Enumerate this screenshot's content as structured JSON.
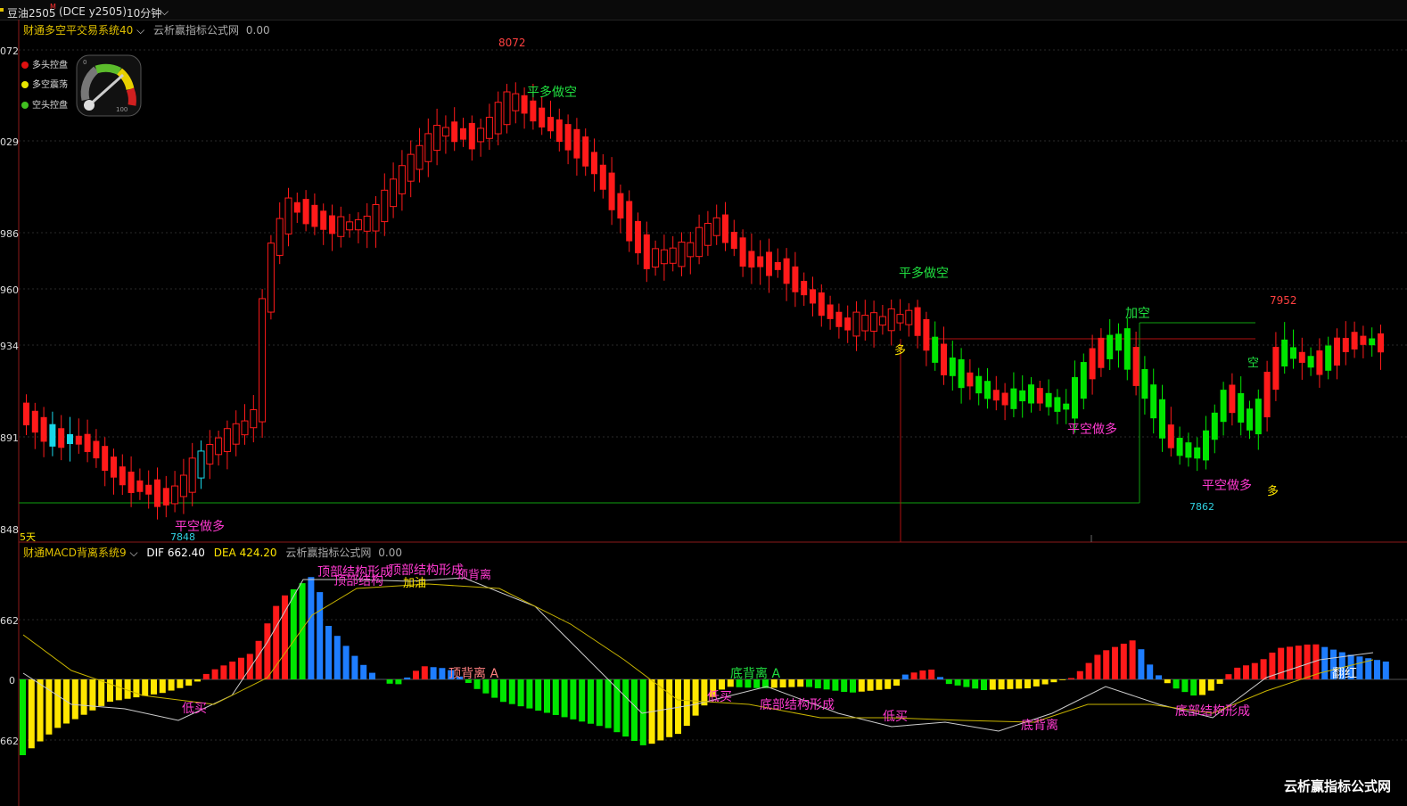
{
  "header": {
    "symbol": "豆油2505",
    "symbol_mark": "M",
    "contract": "(DCE  y2505)",
    "period": "10分钟"
  },
  "main_indicator": {
    "name": "财通多空平交易系统40",
    "source": "云析赢指标公式网",
    "value": "0.00"
  },
  "legend": {
    "items": [
      {
        "label": "多头控盘",
        "color": "#e01010"
      },
      {
        "label": "多空震荡",
        "color": "#e8e800"
      },
      {
        "label": "空头控盘",
        "color": "#40c020"
      }
    ],
    "gauge_min": "0",
    "gauge_max": "100"
  },
  "y_axis_main": [
    "072",
    "029",
    "986",
    "960",
    "934",
    "891",
    "848"
  ],
  "y_axis_macd": [
    "662",
    "0",
    "662"
  ],
  "period_label": "5天",
  "price_marks": {
    "high": "8072",
    "low_left": "7848",
    "high_right": "7952",
    "low_right": "7862"
  },
  "signals": {
    "s1": "平多做空",
    "s2": "平空做多",
    "s3": "平多做空",
    "s4": "多",
    "s5": "加空",
    "s6": "平空做多",
    "s7": "空",
    "s8": "平空做多",
    "s9": "多"
  },
  "macd_indicator": {
    "name": "财通MACD背离系统9",
    "dif_label": "DIF",
    "dif_value": "662.40",
    "dea_label": "DEA",
    "dea_value": "424.20",
    "source": "云析赢指标公式网",
    "value": "0.00"
  },
  "macd_labels": {
    "m1": "顶部结构形成",
    "m2": "顶部结构",
    "m3": "顶部结构形成",
    "m4": "加油",
    "m5": "顶背离",
    "m6": "顶背离 A",
    "m7": "底背离 A",
    "m8": "低买",
    "m9": "低买",
    "m10": "底部结构形成",
    "m11": "低买",
    "m12": "底背离",
    "m13": "底部结构形成",
    "m14": "翻红"
  },
  "watermark": "云析赢指标公式网",
  "colors": {
    "up": "#ff1a1a",
    "down": "#00e600",
    "cyan": "#19d7e8",
    "yellow": "#ffe600",
    "blue": "#1e7dff",
    "magenta": "#ff1ad9"
  }
}
